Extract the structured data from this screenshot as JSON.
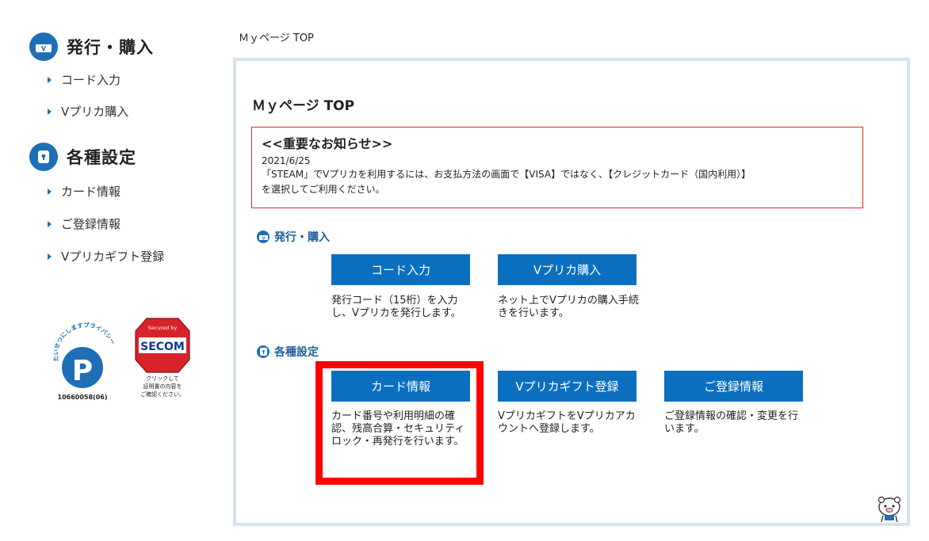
{
  "sidebar": {
    "sections": [
      {
        "title": "発行・購入",
        "icon": "wallet-icon",
        "items": [
          {
            "label": "コード入力"
          },
          {
            "label": "Vプリカ購入"
          }
        ]
      },
      {
        "title": "各種設定",
        "icon": "lock-icon",
        "items": [
          {
            "label": "カード情報"
          },
          {
            "label": "ご登録情報"
          },
          {
            "label": "Vプリカギフト登録"
          }
        ]
      }
    ],
    "privacy_mark": {
      "text": "たいせつにしますプライバシー",
      "number": "10660058(06)"
    },
    "secom_seal": {
      "text_top": "Secured by",
      "brand": "SECOM",
      "caption_1": "クリックして",
      "caption_2": "証明書の内容を",
      "caption_3": "ご確認ください。"
    }
  },
  "breadcrumb": "Ｍｙページ TOP",
  "main": {
    "title": "Ｍｙページ TOP",
    "notice": {
      "heading": "<<重要なお知らせ>>",
      "date": "2021/6/25",
      "line1": "「STEAM」でVプリカを利用するには、お支払方法の画面で【VISA】ではなく、【クレジットカード（国内利用）】",
      "line2": "を選択してご利用ください。"
    },
    "sections": [
      {
        "title": "発行・購入",
        "tiles": [
          {
            "button": "コード入力",
            "description": "発行コード（15桁）を入力し、Vプリカを発行します。"
          },
          {
            "button": "Vプリカ購入",
            "description": "ネット上でVプリカの購入手続きを行います。"
          }
        ]
      },
      {
        "title": "各種設定",
        "tiles": [
          {
            "button": "カード情報",
            "description": "カード番号や利用明細の確認、残高合算・セキュリティロック・再発行を行います。"
          },
          {
            "button": "Vプリカギフト登録",
            "description": "VプリカギフトをVプリカアカウントへ登録します。"
          },
          {
            "button": "ご登録情報",
            "description": "ご登録情報の確認・変更を行います。"
          }
        ]
      }
    ]
  },
  "colors": {
    "brand_blue": "#0a6fbf",
    "notice_border": "#e8262d",
    "highlight": "#ff0000",
    "panel_border": "#d6e2ee"
  }
}
